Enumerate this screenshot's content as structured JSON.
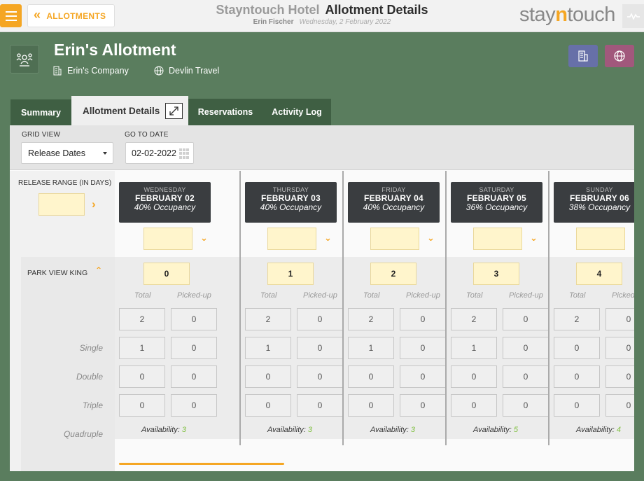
{
  "header": {
    "back_label": "ALLOTMENTS",
    "hotel_name": "Stayntouch Hotel",
    "page_title": "Allotment Details",
    "user_name": "Erin Fischer",
    "date": "Wednesday, 2 February 2022",
    "logo": {
      "pre": "stay",
      "mid": "n",
      "post": "touch"
    }
  },
  "allotment": {
    "title": "Erin's Allotment",
    "company": "Erin's Company",
    "travel_agent": "Devlin Travel"
  },
  "tabs": [
    {
      "label": "Summary"
    },
    {
      "label": "Allotment Details",
      "active": true
    },
    {
      "label": "Reservations"
    },
    {
      "label": "Activity Log"
    }
  ],
  "filters": {
    "grid_view_label": "GRID VIEW",
    "grid_view_value": "Release Dates",
    "go_to_date_label": "GO TO DATE",
    "go_to_date_value": "02-02-2022"
  },
  "left": {
    "release_range_label": "RELEASE RANGE (IN DAYS)",
    "room_type": "PARK VIEW KING",
    "occupancy_labels": [
      "Single",
      "Double",
      "Triple",
      "Quadruple"
    ]
  },
  "grid_col_labels": {
    "total": "Total",
    "picked": "Picked-up"
  },
  "availability_label": "Availability:",
  "days": [
    {
      "dow": "WEDNESDAY",
      "date": "FEBRUARY 02",
      "occupancy": "40% Occupancy",
      "release": "0",
      "rows": [
        [
          "2",
          "0"
        ],
        [
          "1",
          "0"
        ],
        [
          "0",
          "0"
        ],
        [
          "0",
          "0"
        ]
      ],
      "availability": "3"
    },
    {
      "dow": "THURSDAY",
      "date": "FEBRUARY 03",
      "occupancy": "40% Occupancy",
      "release": "1",
      "rows": [
        [
          "2",
          "0"
        ],
        [
          "1",
          "0"
        ],
        [
          "0",
          "0"
        ],
        [
          "0",
          "0"
        ]
      ],
      "availability": "3"
    },
    {
      "dow": "FRIDAY",
      "date": "FEBRUARY 04",
      "occupancy": "40% Occupancy",
      "release": "2",
      "rows": [
        [
          "2",
          "0"
        ],
        [
          "1",
          "0"
        ],
        [
          "0",
          "0"
        ],
        [
          "0",
          "0"
        ]
      ],
      "availability": "3"
    },
    {
      "dow": "SATURDAY",
      "date": "FEBRUARY 05",
      "occupancy": "36% Occupancy",
      "release": "3",
      "rows": [
        [
          "2",
          "0"
        ],
        [
          "1",
          "0"
        ],
        [
          "0",
          "0"
        ],
        [
          "0",
          "0"
        ]
      ],
      "availability": "5"
    },
    {
      "dow": "SUNDAY",
      "date": "FEBRUARY 06",
      "occupancy": "38% Occupancy",
      "release": "4",
      "rows": [
        [
          "2",
          "0"
        ],
        [
          "0",
          "0"
        ],
        [
          "0",
          "0"
        ],
        [
          "0",
          "0"
        ]
      ],
      "availability": "4"
    }
  ],
  "colors": {
    "accent": "#f5a623",
    "background": "#5a7d5e",
    "tab_dark": "#3f5f43",
    "availability": "#7fbf3f"
  }
}
